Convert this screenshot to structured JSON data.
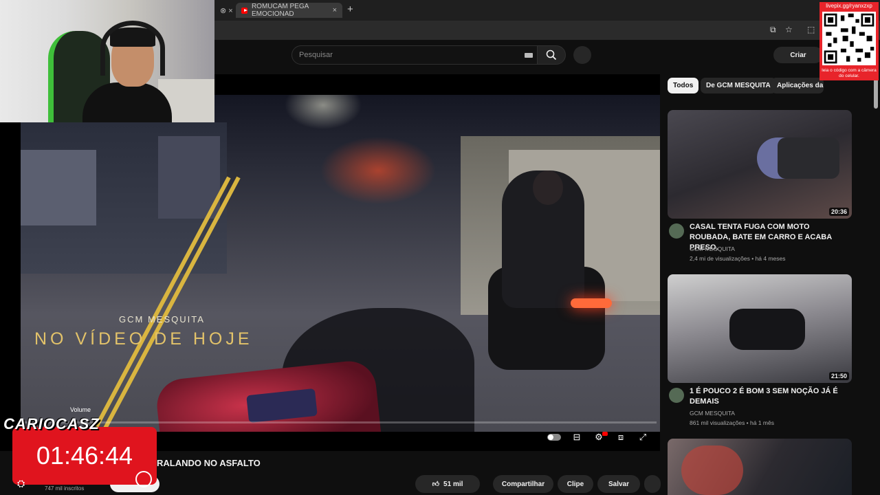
{
  "browser": {
    "tabs": [
      {
        "label": "ROMUCAM PEGA EMOCIONAD",
        "close": "×"
      }
    ],
    "new_tab": "+"
  },
  "youtube": {
    "search_placeholder": "Pesquisar",
    "create_label": "Criar",
    "video_title": "RALANDO NO ASFALTO",
    "subscribers": "747 mil inscritos",
    "likes": "51 mil",
    "share_label": "Compartilhar",
    "clip_label": "Clipe",
    "save_label": "Salvar",
    "volume_tooltip": "Volume",
    "progress": 0.0
  },
  "video_overlay": {
    "brand": "GCM MESQUITA",
    "headline": "NO VÍDEO DE HOJE"
  },
  "sidebar": {
    "chips": [
      {
        "label": "Todos",
        "active": true
      },
      {
        "label": "De GCM MESQUITA",
        "active": false
      },
      {
        "label": "Aplicações da lei",
        "active": false
      }
    ],
    "videos": [
      {
        "title": "CASAL TENTA FUGA COM MOTO ROUBADA, BATE EM CARRO E ACABA PRESO.",
        "channel": "GCM MESQUITA",
        "meta": "2,4 mi de visualizações • há 4 meses",
        "duration": "20:36"
      },
      {
        "title": "1 É POUCO 2 É BOM 3 SEM NOÇÃO JÁ É DEMAIS",
        "channel": "GCM MESQUITA",
        "meta": "861 mil visualizações • há 1 mês",
        "duration": "21:50"
      }
    ]
  },
  "stream": {
    "qr_url": "livepix.gg/ryanxzxp",
    "qr_caption": "leia o código com a câmera do celular.",
    "timer_brand": "CARIOCASZ",
    "timer": "01:46:44"
  },
  "colors": {
    "youtube_red": "#ff0000",
    "timer_red": "#e0141e",
    "overlay_gold": "#e3c36a"
  }
}
